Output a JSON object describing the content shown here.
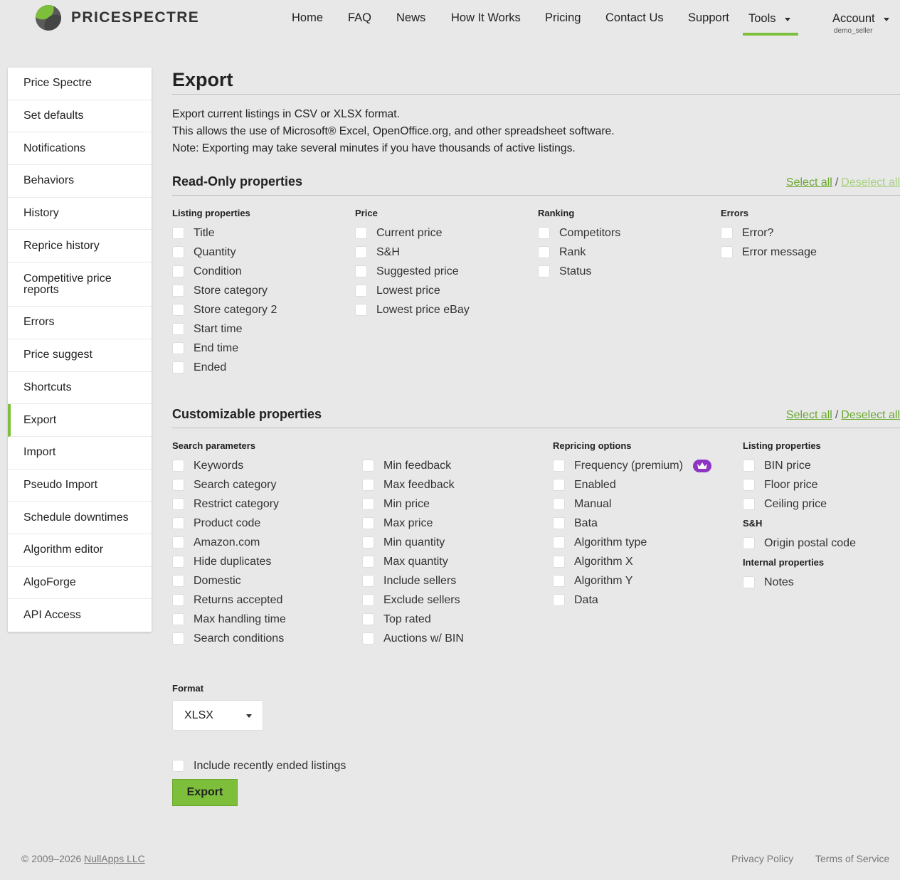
{
  "brand": {
    "name": "PRICESPECTRE"
  },
  "nav": {
    "items": [
      "Home",
      "FAQ",
      "News",
      "How It Works",
      "Pricing",
      "Contact Us",
      "Support"
    ],
    "tools": "Tools",
    "account": "Account",
    "account_user": "demo_seller"
  },
  "sidebar": {
    "items": [
      "Price Spectre",
      "Set defaults",
      "Notifications",
      "Behaviors",
      "History",
      "Reprice history",
      "Competitive price reports",
      "Errors",
      "Price suggest",
      "Shortcuts",
      "Export",
      "Import",
      "Pseudo Import",
      "Schedule downtimes",
      "Algorithm editor",
      "AlgoForge",
      "API Access"
    ],
    "active": "Export"
  },
  "page": {
    "title": "Export",
    "intro": [
      "Export current listings in CSV or XLSX format.",
      "This allows the use of Microsoft® Excel, OpenOffice.org, and other spreadsheet software.",
      "Note: Exporting may take several minutes if you have thousands of active listings."
    ]
  },
  "readonly": {
    "title": "Read-Only properties",
    "select_all": "Select all",
    "deselect_all": "Deselect all",
    "groups": {
      "listing": {
        "heading": "Listing properties",
        "items": [
          "Title",
          "Quantity",
          "Condition",
          "Store category",
          "Store category 2",
          "Start time",
          "End time",
          "Ended"
        ]
      },
      "price": {
        "heading": "Price",
        "items": [
          "Current price",
          "S&H",
          "Suggested price",
          "Lowest price",
          "Lowest price eBay"
        ]
      },
      "ranking": {
        "heading": "Ranking",
        "items": [
          "Competitors",
          "Rank",
          "Status"
        ]
      },
      "errors": {
        "heading": "Errors",
        "items": [
          "Error?",
          "Error message"
        ]
      }
    }
  },
  "custom": {
    "title": "Customizable properties",
    "select_all": "Select all",
    "deselect_all": "Deselect all",
    "search": {
      "heading": "Search parameters",
      "col1": [
        "Keywords",
        "Search category",
        "Restrict category",
        "Product code",
        "Amazon.com",
        "Hide duplicates",
        "Domestic",
        "Returns accepted",
        "Max handling time",
        "Search conditions"
      ],
      "col2": [
        "Min feedback",
        "Max feedback",
        "Min price",
        "Max price",
        "Min quantity",
        "Max quantity",
        "Include sellers",
        "Exclude sellers",
        "Top rated",
        "Auctions w/ BIN"
      ]
    },
    "repricing": {
      "heading": "Repricing options",
      "items": [
        "Frequency (premium)",
        "Enabled",
        "Manual",
        "Bata",
        "Algorithm type",
        "Algorithm X",
        "Algorithm Y",
        "Data"
      ]
    },
    "listing": {
      "heading": "Listing properties",
      "items": [
        "BIN price",
        "Floor price",
        "Ceiling price"
      ],
      "sh_heading": "S&H",
      "sh_items": [
        "Origin postal code"
      ],
      "internal_heading": "Internal properties",
      "internal_items": [
        "Notes"
      ]
    }
  },
  "format": {
    "label": "Format",
    "value": "XLSX"
  },
  "include_ended": "Include recently ended listings",
  "export_button": "Export",
  "footer": {
    "copyright": "© 2009–2026",
    "company": "NullApps LLC",
    "privacy": "Privacy Policy",
    "terms": "Terms of Service"
  },
  "colors": {
    "accent": "#7dbf3a",
    "premium": "#8e35c4",
    "background": "#e8e8e9"
  }
}
